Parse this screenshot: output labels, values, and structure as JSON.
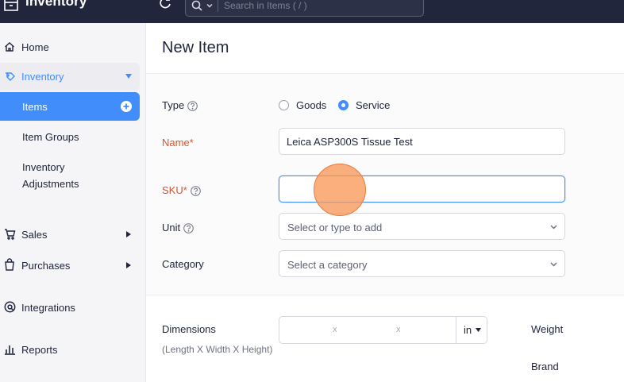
{
  "topbar": {
    "app_title": "Inventory",
    "search_placeholder": "Search in Items ( / )",
    "icons": [
      "inventory-box-icon",
      "refresh-icon",
      "search-icon",
      "chevron-down-icon"
    ]
  },
  "sidebar": {
    "home": "Home",
    "inventory": "Inventory",
    "items": "Items",
    "item_groups": "Item Groups",
    "inventory_adjustments_line1": "Inventory",
    "inventory_adjustments_line2": "Adjustments",
    "sales": "Sales",
    "purchases": "Purchases",
    "integrations": "Integrations",
    "reports": "Reports"
  },
  "main": {
    "page_title": "New Item",
    "type_label": "Type",
    "type_options": [
      "Goods",
      "Service"
    ],
    "type_selected": "Service",
    "name_label": "Name*",
    "name_value": "Leica ASP300S Tissue Test",
    "sku_label": "SKU*",
    "sku_value": "",
    "unit_label": "Unit",
    "unit_placeholder": "Select or type to add",
    "category_label": "Category",
    "category_placeholder": "Select a category",
    "dimensions_label": "Dimensions",
    "dimensions_sub": "(Length X Width X Height)",
    "dimensions_sep": "x",
    "dimensions_unit": "in",
    "weight_label": "Weight",
    "brand_label": "Brand"
  },
  "colors": {
    "topbar": "#21263c",
    "accent": "#408dfb",
    "required": "#d6542f",
    "cursor": "#f89858"
  }
}
